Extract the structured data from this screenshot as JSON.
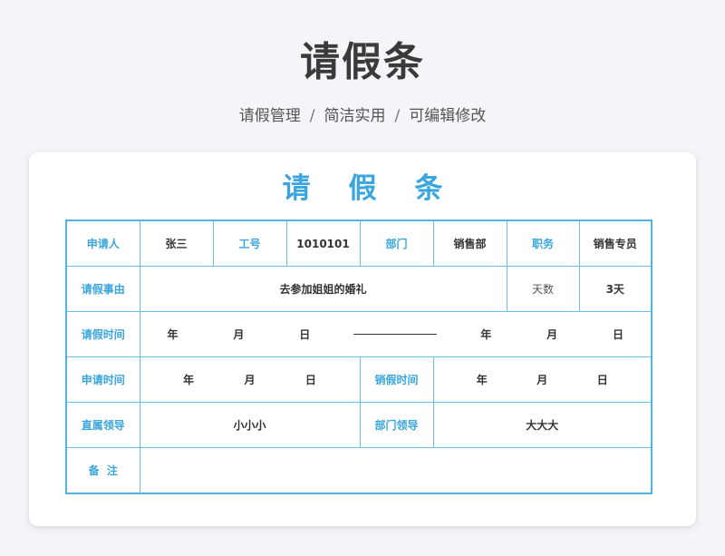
{
  "page": {
    "title": "请假条",
    "subtitle_parts": [
      "请假管理",
      "简洁实用",
      "可编辑修改"
    ],
    "separator": "/"
  },
  "form": {
    "title": "请假条",
    "applicant_label": "申请人",
    "applicant_value": "张三",
    "employee_id_label": "工号",
    "employee_id_value": "1010101",
    "department_label": "部门",
    "department_value": "销售部",
    "position_label": "职务",
    "position_value": "销售专员",
    "reason_label": "请假事由",
    "reason_value": "去参加姐姐的婚礼",
    "days_label": "天数",
    "days_value": "3天",
    "leave_time_label": "请假时间",
    "apply_time_label": "申请时间",
    "cancel_time_label": "销假时间",
    "date_units": {
      "year": "年",
      "month": "月",
      "day": "日"
    },
    "direct_leader_label": "直属领导",
    "direct_leader_value": "小小小",
    "dept_leader_label": "部门领导",
    "dept_leader_value": "大大大",
    "remarks_label": "备  注",
    "remarks_value": ""
  },
  "colors": {
    "accent": "#3aa6dd",
    "border": "#6cc1ea",
    "background": "#f3f5f8"
  }
}
